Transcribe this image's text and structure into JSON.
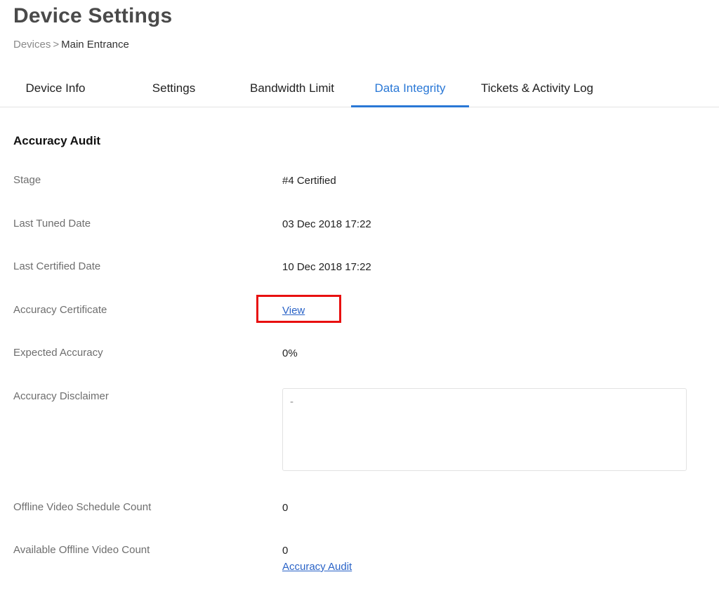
{
  "header": {
    "title": "Device Settings",
    "breadcrumb": {
      "root": "Devices",
      "separator": ">",
      "current": "Main Entrance"
    }
  },
  "tabs": [
    {
      "label": "Device Info",
      "active": false
    },
    {
      "label": "Settings",
      "active": false
    },
    {
      "label": "Bandwidth Limit",
      "active": false
    },
    {
      "label": "Data Integrity",
      "active": true
    },
    {
      "label": "Tickets & Activity Log",
      "active": false
    }
  ],
  "accent_color": "#2a78d6",
  "highlight_color": "#e81010",
  "section": {
    "title": "Accuracy Audit",
    "rows": {
      "stage": {
        "label": "Stage",
        "value": "#4 Certified"
      },
      "last_tuned": {
        "label": "Last Tuned Date",
        "value": "03 Dec 2018 17:22"
      },
      "last_certified": {
        "label": "Last Certified Date",
        "value": "10 Dec 2018 17:22"
      },
      "certificate": {
        "label": "Accuracy Certificate",
        "link": "View"
      },
      "expected_accuracy": {
        "label": "Expected Accuracy",
        "value": "0%"
      },
      "disclaimer": {
        "label": "Accuracy Disclaimer",
        "value": "-"
      },
      "offline_schedule": {
        "label": "Offline Video Schedule Count",
        "value": "0"
      },
      "available_offline": {
        "label": "Available Offline Video Count",
        "value": "0",
        "link": "Accuracy Audit"
      }
    }
  }
}
